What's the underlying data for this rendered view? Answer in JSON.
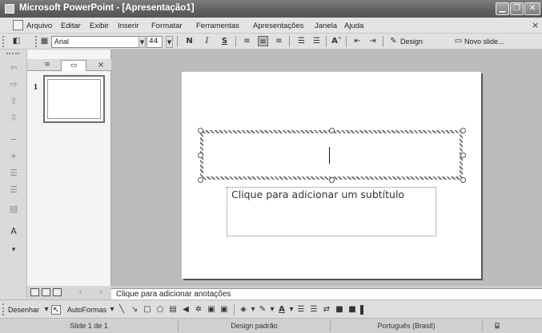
{
  "window": {
    "title": "Microsoft PowerPoint - [Apresentação1]",
    "controls": {
      "minimize": "▁",
      "restore": "❐",
      "close": "✕"
    }
  },
  "menubar": {
    "items": [
      "Arquivo",
      "Editar",
      "Exibir",
      "Inserir",
      "Formatar",
      "Ferramentas",
      "Apresentações",
      "Janela",
      "Ajuda"
    ],
    "close_doc": "×"
  },
  "toolbar": {
    "font": "Arial",
    "size": "44",
    "bold": "N",
    "italic": "I",
    "underline": "S",
    "design": "Design",
    "new_slide": "Novo slide..."
  },
  "outline_pane": {
    "close": "×",
    "slide_number": "1"
  },
  "slide": {
    "subtitle_placeholder": "Clique para adicionar um subtítulo"
  },
  "notes": {
    "placeholder": "Clique para adicionar anotações"
  },
  "drawing_toolbar": {
    "draw": "Desenhar",
    "autoshapes": "AutoFormas"
  },
  "statusbar": {
    "slide_info": "Slide 1 de 1",
    "design": "Design padrão",
    "language": "Português (Brasil)"
  }
}
